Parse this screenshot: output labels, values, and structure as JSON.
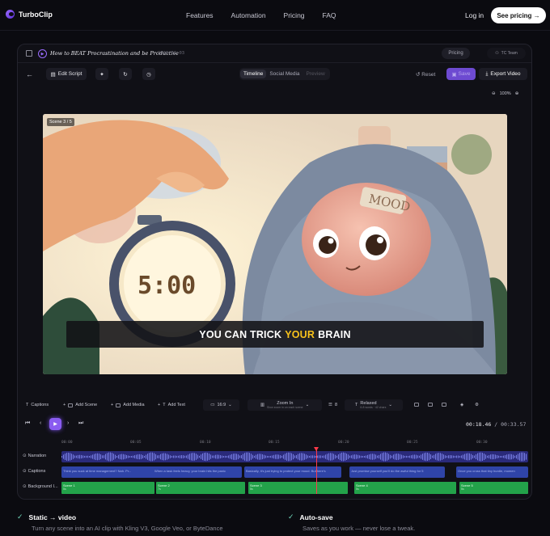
{
  "nav": {
    "brand": "TurboClip",
    "links": [
      "Features",
      "Automation",
      "Pricing",
      "FAQ"
    ],
    "login": "Log in",
    "cta": "See pricing →"
  },
  "editor": {
    "doc_title": "How to BEAT Procrastination and be Productive",
    "doc_date": "2026-06-03",
    "pricing_pill": "Pricing",
    "team": "TC Team",
    "edit_script": "Edit Script",
    "views": [
      "Timeline",
      "Social Media",
      "Preview"
    ],
    "reset": "Reset",
    "save": "Save",
    "export": "Export Video",
    "zoom": "100%",
    "scene_tag": "Scene 3 / 5",
    "caption_pre": "YOU CAN TRICK",
    "caption_hl": "YOUR",
    "caption_post": "BRAIN",
    "tools": {
      "captions": "Captions",
      "add_scene": "Add Scene",
      "add_media": "Add Media",
      "add_text": "Add Text",
      "aspect": "16:9",
      "zoom_in": "Zoom In",
      "zoom_in_sub": "Slow zoom in on each scene",
      "words": "8",
      "pace": "Relaxed",
      "pace_sub": "6-8 words · 42 chars"
    },
    "time_current": "00:18.46",
    "time_total": "00:33.57",
    "ruler": [
      "00:00",
      "00:05",
      "00:10",
      "00:15",
      "00:20",
      "00:25",
      "00:30"
    ],
    "tracks": {
      "narration": "Narration",
      "captions": "Captions",
      "background": "Background I..."
    },
    "caption_clips": [
      "Think you suck at time management? Nah. Pr...",
      "When a task feels heavy, your brain hits the panic",
      "Basically, it's just trying to protect your mood. But here's",
      "Just promise yourself you'll do the awful thing for 5",
      "Once you cross that tiny hurdle, momen"
    ],
    "bg_clips": [
      {
        "name": "Scene 1",
        "sub": "5s"
      },
      {
        "name": "Scene 2",
        "sub": "7s"
      },
      {
        "name": "Scene 3",
        "sub": "5s"
      },
      {
        "name": "Scene 4",
        "sub": "5s"
      },
      {
        "name": "Scene 5",
        "sub": "5s"
      }
    ]
  },
  "features": [
    {
      "title": "Static → video",
      "desc": "Turn any scene into an AI clip with Kling V3, Google Veo, or ByteDance"
    },
    {
      "title": "Auto-save",
      "desc": "Saves as you work — never lose a tweak."
    }
  ],
  "colors": {
    "accent": "#8a5cf0",
    "caption_highlight": "#f7c21c",
    "playhead": "#ff3a4a",
    "bg_track": "#23a24a"
  }
}
